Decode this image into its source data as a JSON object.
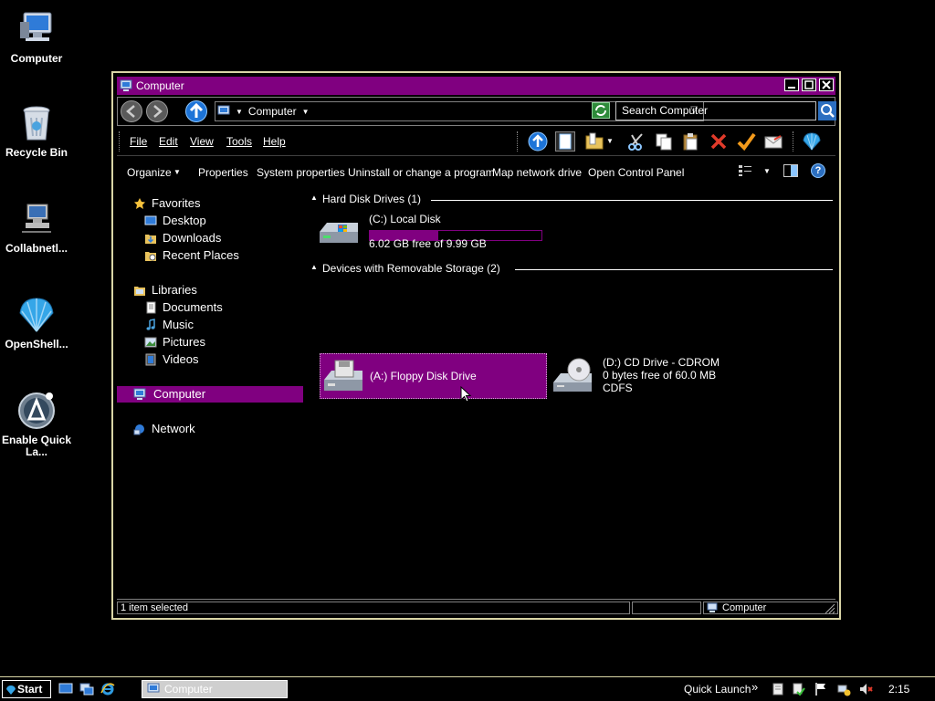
{
  "desktop": {
    "icons": [
      {
        "label": "Computer"
      },
      {
        "label": "Recycle Bin"
      },
      {
        "label": "Collabnetl..."
      },
      {
        "label": "OpenShell..."
      },
      {
        "label": "Enable Quick La..."
      }
    ]
  },
  "window": {
    "title": "Computer",
    "address": {
      "location": "Computer"
    },
    "search": {
      "value": "Search Computer"
    },
    "menu": [
      "File",
      "Edit",
      "View",
      "Tools",
      "Help"
    ],
    "commands": [
      "Organize",
      "Properties",
      "System properties",
      "Uninstall or change a program",
      "Map network drive",
      "Open Control Panel"
    ],
    "nav": {
      "favorites": {
        "label": "Favorites",
        "items": [
          "Desktop",
          "Downloads",
          "Recent Places"
        ]
      },
      "libraries": {
        "label": "Libraries",
        "items": [
          "Documents",
          "Music",
          "Pictures",
          "Videos"
        ]
      },
      "computer": "Computer",
      "network": "Network"
    },
    "groups": {
      "hdd": {
        "header": "Hard Disk Drives (1)",
        "drives": [
          {
            "name": "(C:) Local Disk",
            "free": "6.02 GB free of 9.99 GB",
            "used_fraction": 0.4
          }
        ]
      },
      "removable": {
        "header": "Devices with Removable Storage (2)",
        "drives": [
          {
            "name": "(A:) Floppy Disk Drive",
            "selected": true
          },
          {
            "name": "(D:) CD Drive - CDROM",
            "free": "0 bytes free of 60.0 MB",
            "fs": "CDFS"
          }
        ]
      }
    },
    "status": {
      "selection": "1 item selected",
      "location": "Computer"
    }
  },
  "taskbar": {
    "start": "Start",
    "task": "Computer",
    "quick_launch": "Quick Launch",
    "chevron": "»",
    "clock": "2:15"
  },
  "colors": {
    "accent": "#800080",
    "frame": "#d9d5a6",
    "background": "#000000",
    "text": "#ffffff"
  }
}
